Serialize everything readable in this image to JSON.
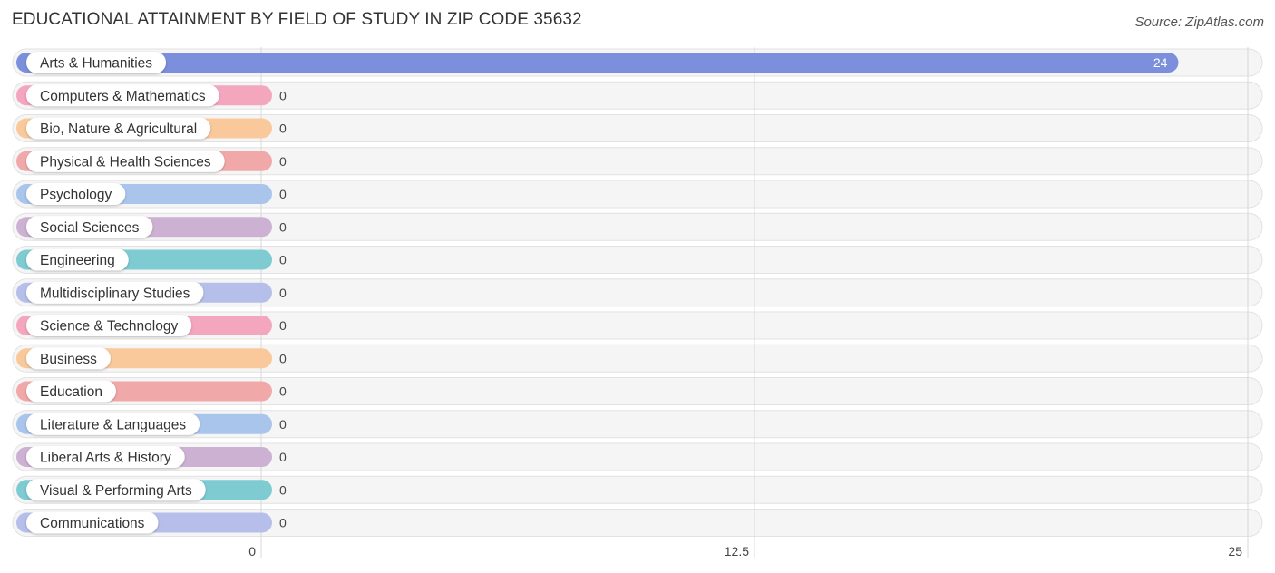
{
  "header": {
    "title": "EDUCATIONAL ATTAINMENT BY FIELD OF STUDY IN ZIP CODE 35632",
    "source": "Source: ZipAtlas.com"
  },
  "chart_data": {
    "type": "bar",
    "orientation": "horizontal",
    "title": "EDUCATIONAL ATTAINMENT BY FIELD OF STUDY IN ZIP CODE 35632",
    "xlabel": "",
    "ylabel": "",
    "xlim": [
      0,
      25
    ],
    "ticks": [
      0,
      12.5,
      25
    ],
    "tick_labels": [
      "0",
      "12.5",
      "25"
    ],
    "grid": true,
    "categories": [
      "Arts & Humanities",
      "Computers & Mathematics",
      "Bio, Nature & Agricultural",
      "Physical & Health Sciences",
      "Psychology",
      "Social Sciences",
      "Engineering",
      "Multidisciplinary Studies",
      "Science & Technology",
      "Business",
      "Education",
      "Literature & Languages",
      "Liberal Arts & History",
      "Visual & Performing Arts",
      "Communications"
    ],
    "values": [
      24,
      0,
      0,
      0,
      0,
      0,
      0,
      0,
      0,
      0,
      0,
      0,
      0,
      0,
      0
    ],
    "value_labels": [
      "24",
      "0",
      "0",
      "0",
      "0",
      "0",
      "0",
      "0",
      "0",
      "0",
      "0",
      "0",
      "0",
      "0",
      "0"
    ],
    "colors": [
      "#7b8fdc",
      "#f4a6bf",
      "#f9c99b",
      "#f0a9a8",
      "#a9c5ec",
      "#cdb1d3",
      "#7ecbd2",
      "#b5bfea",
      "#f4a6bf",
      "#f9c99b",
      "#f0a9a8",
      "#a9c5ec",
      "#cdb1d3",
      "#7ecbd2",
      "#b5bfea"
    ]
  }
}
